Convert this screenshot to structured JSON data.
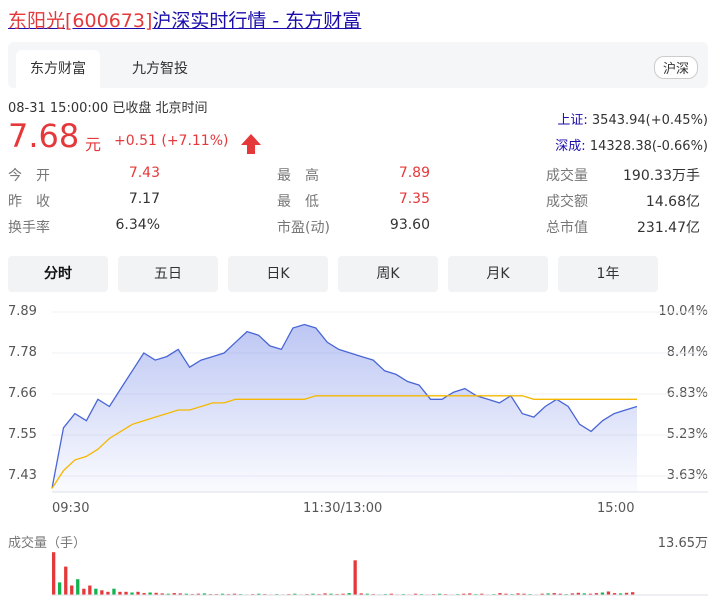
{
  "title": {
    "name": "东阳光",
    "code_display": "[600673]",
    "rest": "沪深实时行情 - 东方财富"
  },
  "tabs": [
    {
      "label": "东方财富"
    },
    {
      "label": "九方智投"
    }
  ],
  "market_badge": "沪深",
  "quote_meta": "08-31 15:00:00  已收盘  北京时间",
  "price": "7.68",
  "price_unit": "元",
  "change": "+0.51 (+7.11%)",
  "indexes": [
    {
      "name": "上证:",
      "value": "3543.94(+0.45%)"
    },
    {
      "name": "深成:",
      "value": "14328.38(-0.66%)"
    }
  ],
  "stats": {
    "col1": [
      {
        "label": "今　开",
        "value": "7.43",
        "color": "red"
      },
      {
        "label": "昨　收",
        "value": "7.17",
        "color": "black"
      },
      {
        "label": "换手率",
        "value": "6.34%",
        "color": "black"
      }
    ],
    "col2": [
      {
        "label": "最　高",
        "value": "7.89",
        "color": "red"
      },
      {
        "label": "最　低",
        "value": "7.35",
        "color": "red"
      },
      {
        "label": "市盈(动)",
        "value": "93.60",
        "color": "black"
      }
    ],
    "col3": [
      {
        "label": "成交量",
        "value": "190.33万手",
        "color": "black"
      },
      {
        "label": "成交额",
        "value": "14.68亿",
        "color": "black"
      },
      {
        "label": "总市值",
        "value": "231.47亿",
        "color": "black"
      }
    ]
  },
  "periods": [
    {
      "label": "分时"
    },
    {
      "label": "五日"
    },
    {
      "label": "日K"
    },
    {
      "label": "周K"
    },
    {
      "label": "月K"
    },
    {
      "label": "1年"
    }
  ],
  "active_period": 0,
  "chart_data": {
    "type": "line",
    "price_ticks": [
      "7.89",
      "7.78",
      "7.66",
      "7.55",
      "7.43"
    ],
    "pct_ticks": [
      "10.04%",
      "8.44%",
      "6.83%",
      "5.23%",
      "3.63%"
    ],
    "time_ticks": [
      "09:30",
      "11:30/13:00",
      "15:00"
    ],
    "ylim": [
      7.4,
      7.905
    ],
    "series": [
      {
        "values": [
          7.41,
          7.58,
          7.62,
          7.6,
          7.66,
          7.64,
          7.69,
          7.74,
          7.79,
          7.77,
          7.78,
          7.8,
          7.75,
          7.77,
          7.78,
          7.79,
          7.82,
          7.85,
          7.84,
          7.81,
          7.8,
          7.86,
          7.87,
          7.86,
          7.82,
          7.8,
          7.79,
          7.78,
          7.77,
          7.74,
          7.73,
          7.71,
          7.7,
          7.66,
          7.66,
          7.68,
          7.69,
          7.67,
          7.66,
          7.65,
          7.67,
          7.62,
          7.61,
          7.64,
          7.66,
          7.64,
          7.59,
          7.57,
          7.6,
          7.62,
          7.63,
          7.64
        ]
      },
      {
        "values": [
          7.41,
          7.46,
          7.49,
          7.5,
          7.52,
          7.55,
          7.57,
          7.59,
          7.6,
          7.61,
          7.62,
          7.63,
          7.63,
          7.64,
          7.65,
          7.65,
          7.66,
          7.66,
          7.66,
          7.66,
          7.66,
          7.66,
          7.66,
          7.67,
          7.67,
          7.67,
          7.67,
          7.67,
          7.67,
          7.67,
          7.67,
          7.67,
          7.67,
          7.67,
          7.67,
          7.67,
          7.67,
          7.67,
          7.67,
          7.67,
          7.67,
          7.67,
          7.66,
          7.66,
          7.66,
          7.66,
          7.66,
          7.66,
          7.66,
          7.66,
          7.66,
          7.66
        ]
      }
    ],
    "volume": {
      "label": "成交量（手）",
      "max_label": "13.65万",
      "values": [
        13.6,
        4,
        9,
        3,
        5,
        2,
        3,
        2,
        1.5,
        1,
        2,
        1,
        1,
        0.8,
        1,
        0.6,
        0.8,
        0.7,
        0.5,
        0.4,
        0.6,
        0.5,
        0.4,
        0.3,
        0.4,
        0.5,
        0.3,
        0.3,
        0.4,
        0.3,
        0.4,
        0.3,
        0.2,
        0.3,
        0.4,
        0.3,
        0.2,
        0.3,
        0.2,
        0.3,
        0.4,
        0.2,
        0.3,
        0.4,
        0.3,
        0.5,
        0.4,
        0.3,
        0.4,
        0.6,
        11,
        0.5,
        0.4,
        0.3,
        0.2,
        0.3,
        0.4,
        0.2,
        0.3,
        0.2,
        0.4,
        0.3,
        0.2,
        0.3,
        0.4,
        0.3,
        0.2,
        0.3,
        0.4,
        0.5,
        0.3,
        0.4,
        0.2,
        0.3,
        0.6,
        0.4,
        0.3,
        0.5,
        0.4,
        0.3,
        0.2,
        0.4,
        0.5,
        0.6,
        0.4,
        0.3,
        0.5,
        0.7,
        0.5,
        0.4,
        0.6,
        0.8,
        1.1,
        0.6,
        0.5,
        0.7,
        0.9
      ]
    },
    "colors": {
      "price_line": "#4a66d6",
      "avg_line": "#f5b800",
      "up": "#e5383b",
      "down": "#13b34f"
    }
  }
}
